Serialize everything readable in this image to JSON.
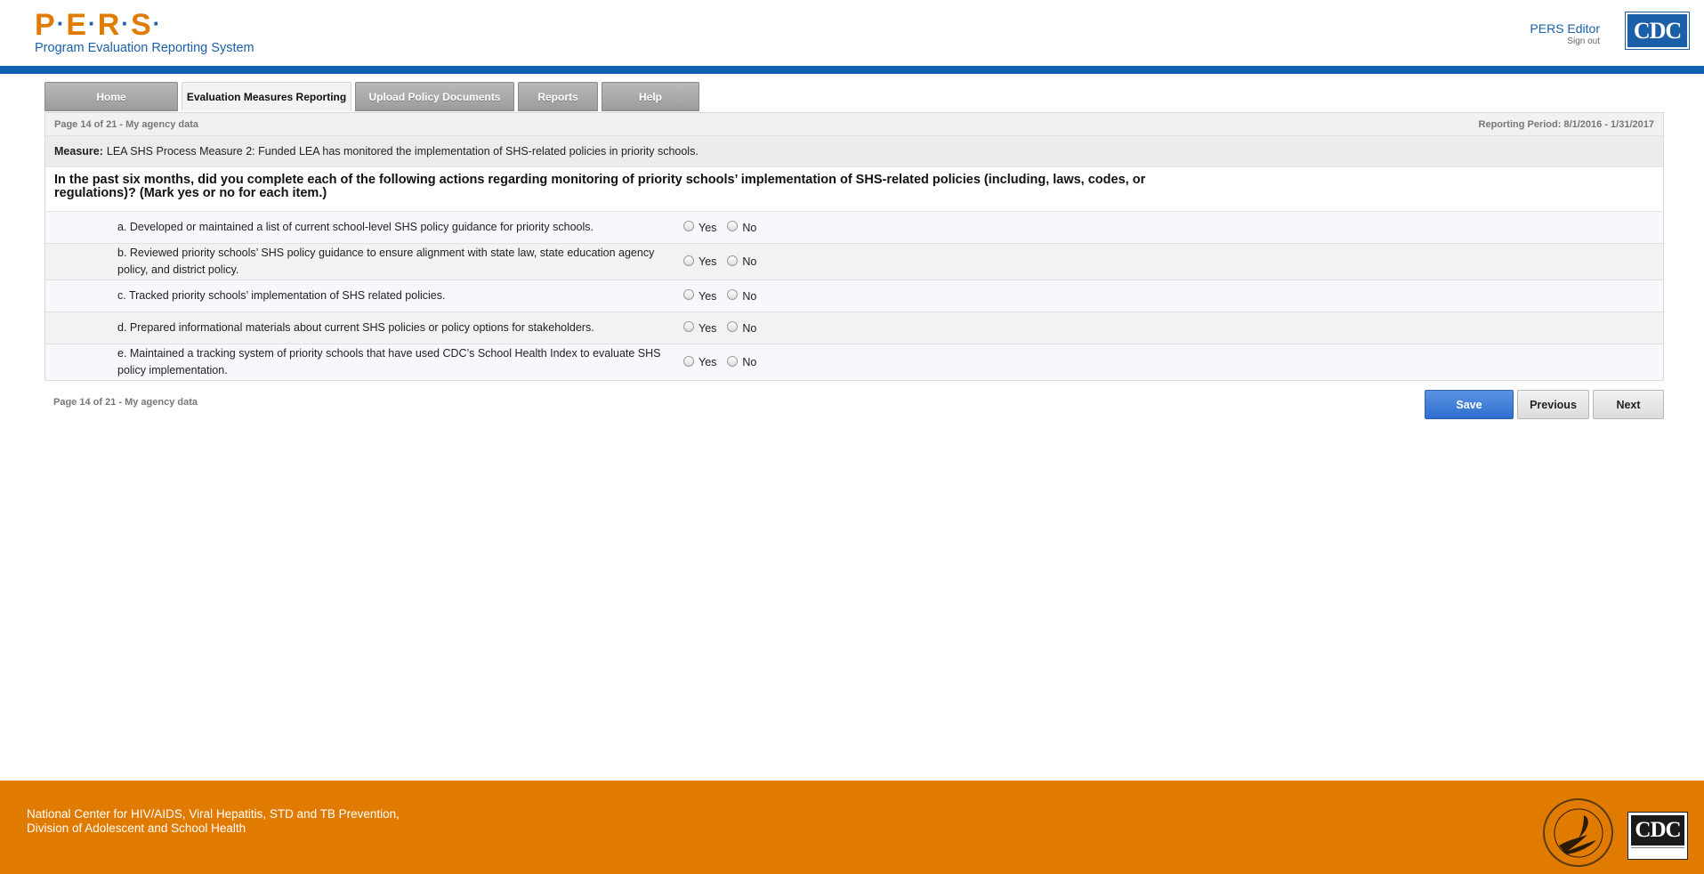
{
  "header": {
    "logo_letters": [
      "P",
      "E",
      "R",
      "S"
    ],
    "logo_subtitle": "Program Evaluation Reporting System",
    "user_name": "PERS Editor",
    "sign_out": "Sign out",
    "agency_logo_text": "CDC"
  },
  "tabs": [
    {
      "label": "Home",
      "active": false
    },
    {
      "label": "Evaluation Measures Reporting",
      "active": true
    },
    {
      "label": "Upload Policy Documents",
      "active": false
    },
    {
      "label": "Reports",
      "active": false
    },
    {
      "label": "Help",
      "active": false
    }
  ],
  "page_info": "Page 14 of 21 - My agency data",
  "reporting_period": "Reporting Period: 8/1/2016 - 1/31/2017",
  "measure": {
    "label": "Measure:",
    "text": "LEA SHS Process Measure 2: Funded LEA has monitored the implementation of SHS-related policies in priority schools."
  },
  "question": "In the past six months, did you complete each of the following actions regarding monitoring of priority schools’ implementation of SHS-related policies (including, laws, codes, or regulations)? (Mark yes or no for each item.)",
  "items": [
    {
      "text": "a. Developed or maintained a list of current school-level SHS policy guidance for priority schools."
    },
    {
      "text": "b. Reviewed priority schools’ SHS policy guidance to ensure alignment with state law, state education agency policy, and district policy."
    },
    {
      "text": "c. Tracked priority schools’ implementation of SHS related policies."
    },
    {
      "text": "d. Prepared informational materials about current SHS policies or policy options for stakeholders."
    },
    {
      "text": "e. Maintained a tracking system of priority schools that have used CDC’s School Health Index to evaluate SHS policy implementation."
    }
  ],
  "options": {
    "yes": "Yes",
    "no": "No"
  },
  "buttons": {
    "save": "Save",
    "previous": "Previous",
    "next": "Next"
  },
  "footer": {
    "line1": "National Center for HIV/AIDS, Viral Hepatitis, STD and TB Prevention,",
    "line2": "Division of Adolescent and School Health",
    "cdc_logo_text": "CDC"
  },
  "colors": {
    "brand_orange": "#e07b00",
    "brand_blue": "#1260b1",
    "save_blue": "#2f6ed1"
  },
  "icons": {
    "hhs_seal": "hhs-eagle-seal",
    "cdc_logo": "cdc-logo"
  }
}
